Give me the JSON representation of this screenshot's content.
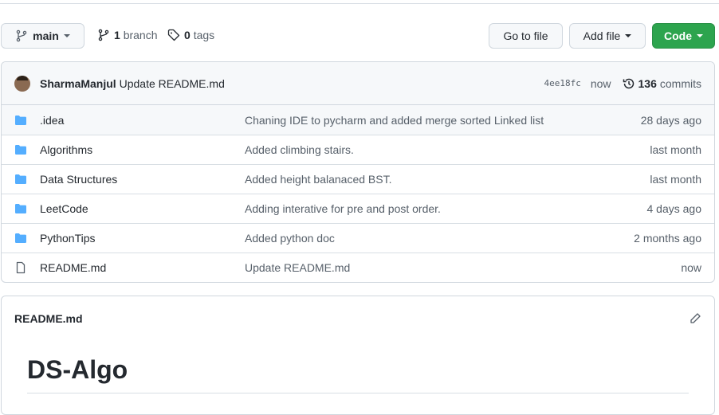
{
  "branch": {
    "name": "main",
    "branch_count": "1",
    "branch_label": "branch",
    "tag_count": "0",
    "tag_label": "tags"
  },
  "actions": {
    "go_to_file": "Go to file",
    "add_file": "Add file",
    "code": "Code"
  },
  "commit": {
    "author": "SharmaManjul",
    "message": "Update README.md",
    "sha": "4ee18fc",
    "time": "now",
    "count": "136",
    "count_label": "commits"
  },
  "files": [
    {
      "type": "folder",
      "name": ".idea",
      "message": "Chaning IDE to pycharm and added merge sorted Linked list",
      "age": "28 days ago"
    },
    {
      "type": "folder",
      "name": "Algorithms",
      "message": "Added climbing stairs.",
      "age": "last month"
    },
    {
      "type": "folder",
      "name": "Data Structures",
      "message": "Added height balanaced BST.",
      "age": "last month"
    },
    {
      "type": "folder",
      "name": "LeetCode",
      "message": "Adding interative for pre and post order.",
      "age": "4 days ago"
    },
    {
      "type": "folder",
      "name": "PythonTips",
      "message": "Added python doc",
      "age": "2 months ago"
    },
    {
      "type": "file",
      "name": "README.md",
      "message": "Update README.md",
      "age": "now"
    }
  ],
  "readme": {
    "filename": "README.md",
    "heading": "DS-Algo"
  },
  "colors": {
    "primary": "#2da44e",
    "folder": "#54aeff"
  }
}
